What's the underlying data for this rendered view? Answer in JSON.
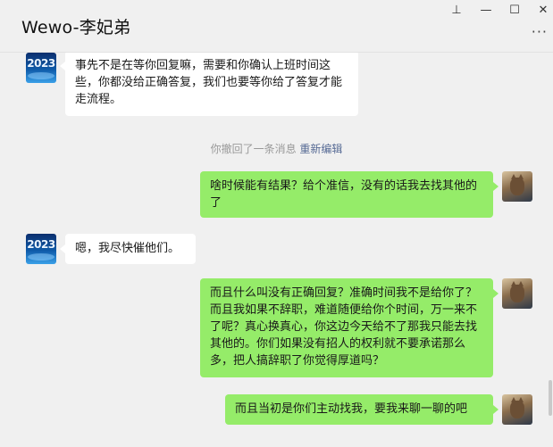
{
  "window": {
    "title": "Wewo-李妃弟",
    "pin_glyph": "⊥",
    "min_glyph": "—",
    "max_glyph": "☐",
    "close_glyph": "✕",
    "more_glyph": "···"
  },
  "avatars": {
    "contact_text": "2023"
  },
  "messages": [
    {
      "id": "m1",
      "side": "in",
      "text": "事先不是在等你回复嘛，需要和你确认上班时间这些，你都没给正确答复，我们也要等你给了答复才能走流程。"
    },
    {
      "id": "m2",
      "side": "out",
      "text": "啥时候能有结果？给个准信，没有的话我去找其他的了"
    },
    {
      "id": "m3",
      "side": "in",
      "text": "嗯，我尽快催他们。"
    },
    {
      "id": "m4",
      "side": "out",
      "text": "而且什么叫没有正确回复？准确时间我不是给你了？而且我如果不辞职，难道随便给你个时间，万一来不了呢？真心换真心，你这边今天给不了那我只能去找其他的。你们如果没有招人的权利就不要承诺那么多，把人搞辞职了你觉得厚道吗？"
    },
    {
      "id": "m5",
      "side": "out",
      "text": "而且当初是你们主动找我，要我来聊一聊的吧"
    }
  ],
  "system_notice": {
    "text": "你撤回了一条消息",
    "link": "重新编辑"
  },
  "colors": {
    "background": "#f0f0f0",
    "incoming_bubble": "#ffffff",
    "outgoing_bubble": "#95ec69",
    "link": "#576b95"
  }
}
